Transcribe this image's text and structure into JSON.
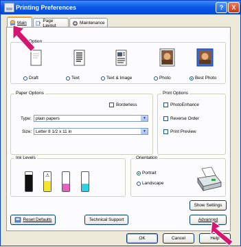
{
  "window": {
    "title": "Printing Preferences",
    "help": "?",
    "close": "X"
  },
  "tabs": [
    {
      "label": "Main"
    },
    {
      "label": "Page Layout"
    },
    {
      "label": "Maintenance"
    }
  ],
  "quality": {
    "group_label": "Quality Option",
    "group_label_visible": "ity Option",
    "options": [
      {
        "label": "Draft"
      },
      {
        "label": "Text"
      },
      {
        "label": "Text & Image"
      },
      {
        "label": "Photo"
      },
      {
        "label": "Best Photo",
        "selected": true
      }
    ]
  },
  "paper": {
    "group_label": "Paper Options",
    "borderless": "Borderless",
    "type_label": "Type:",
    "type_value": "plain papers",
    "size_label": "Size:",
    "size_value": "Letter 8 1/2 x 11 in"
  },
  "print_options": {
    "group_label": "Print Options",
    "photo_enhance": "PhotoEnhance",
    "reverse_order": "Reverse Order",
    "print_preview": "Print Preview"
  },
  "ink": {
    "group_label": "Ink Levels",
    "levels": [
      {
        "color": "#111111",
        "level": 0.85
      },
      {
        "color": "#f6e52a",
        "level": 0.55,
        "warning": true
      },
      {
        "color": "#e85fc4",
        "level": 0.4
      },
      {
        "color": "#2bd3e8",
        "level": 0.4
      }
    ]
  },
  "orientation": {
    "group_label": "Orientation",
    "portrait": "Portrait",
    "landscape": "Landscape"
  },
  "buttons": {
    "show_settings": "Show Settings",
    "reset_defaults": "Reset Defaults",
    "technical_support": "Technical Support",
    "advanced": "Advanced",
    "ok": "OK",
    "cancel": "Cancel",
    "help": "Help"
  },
  "colors": {
    "title_blue": "#0a58e8",
    "pointer_pink": "#d6156f",
    "tab_highlight": "#f5a523"
  }
}
